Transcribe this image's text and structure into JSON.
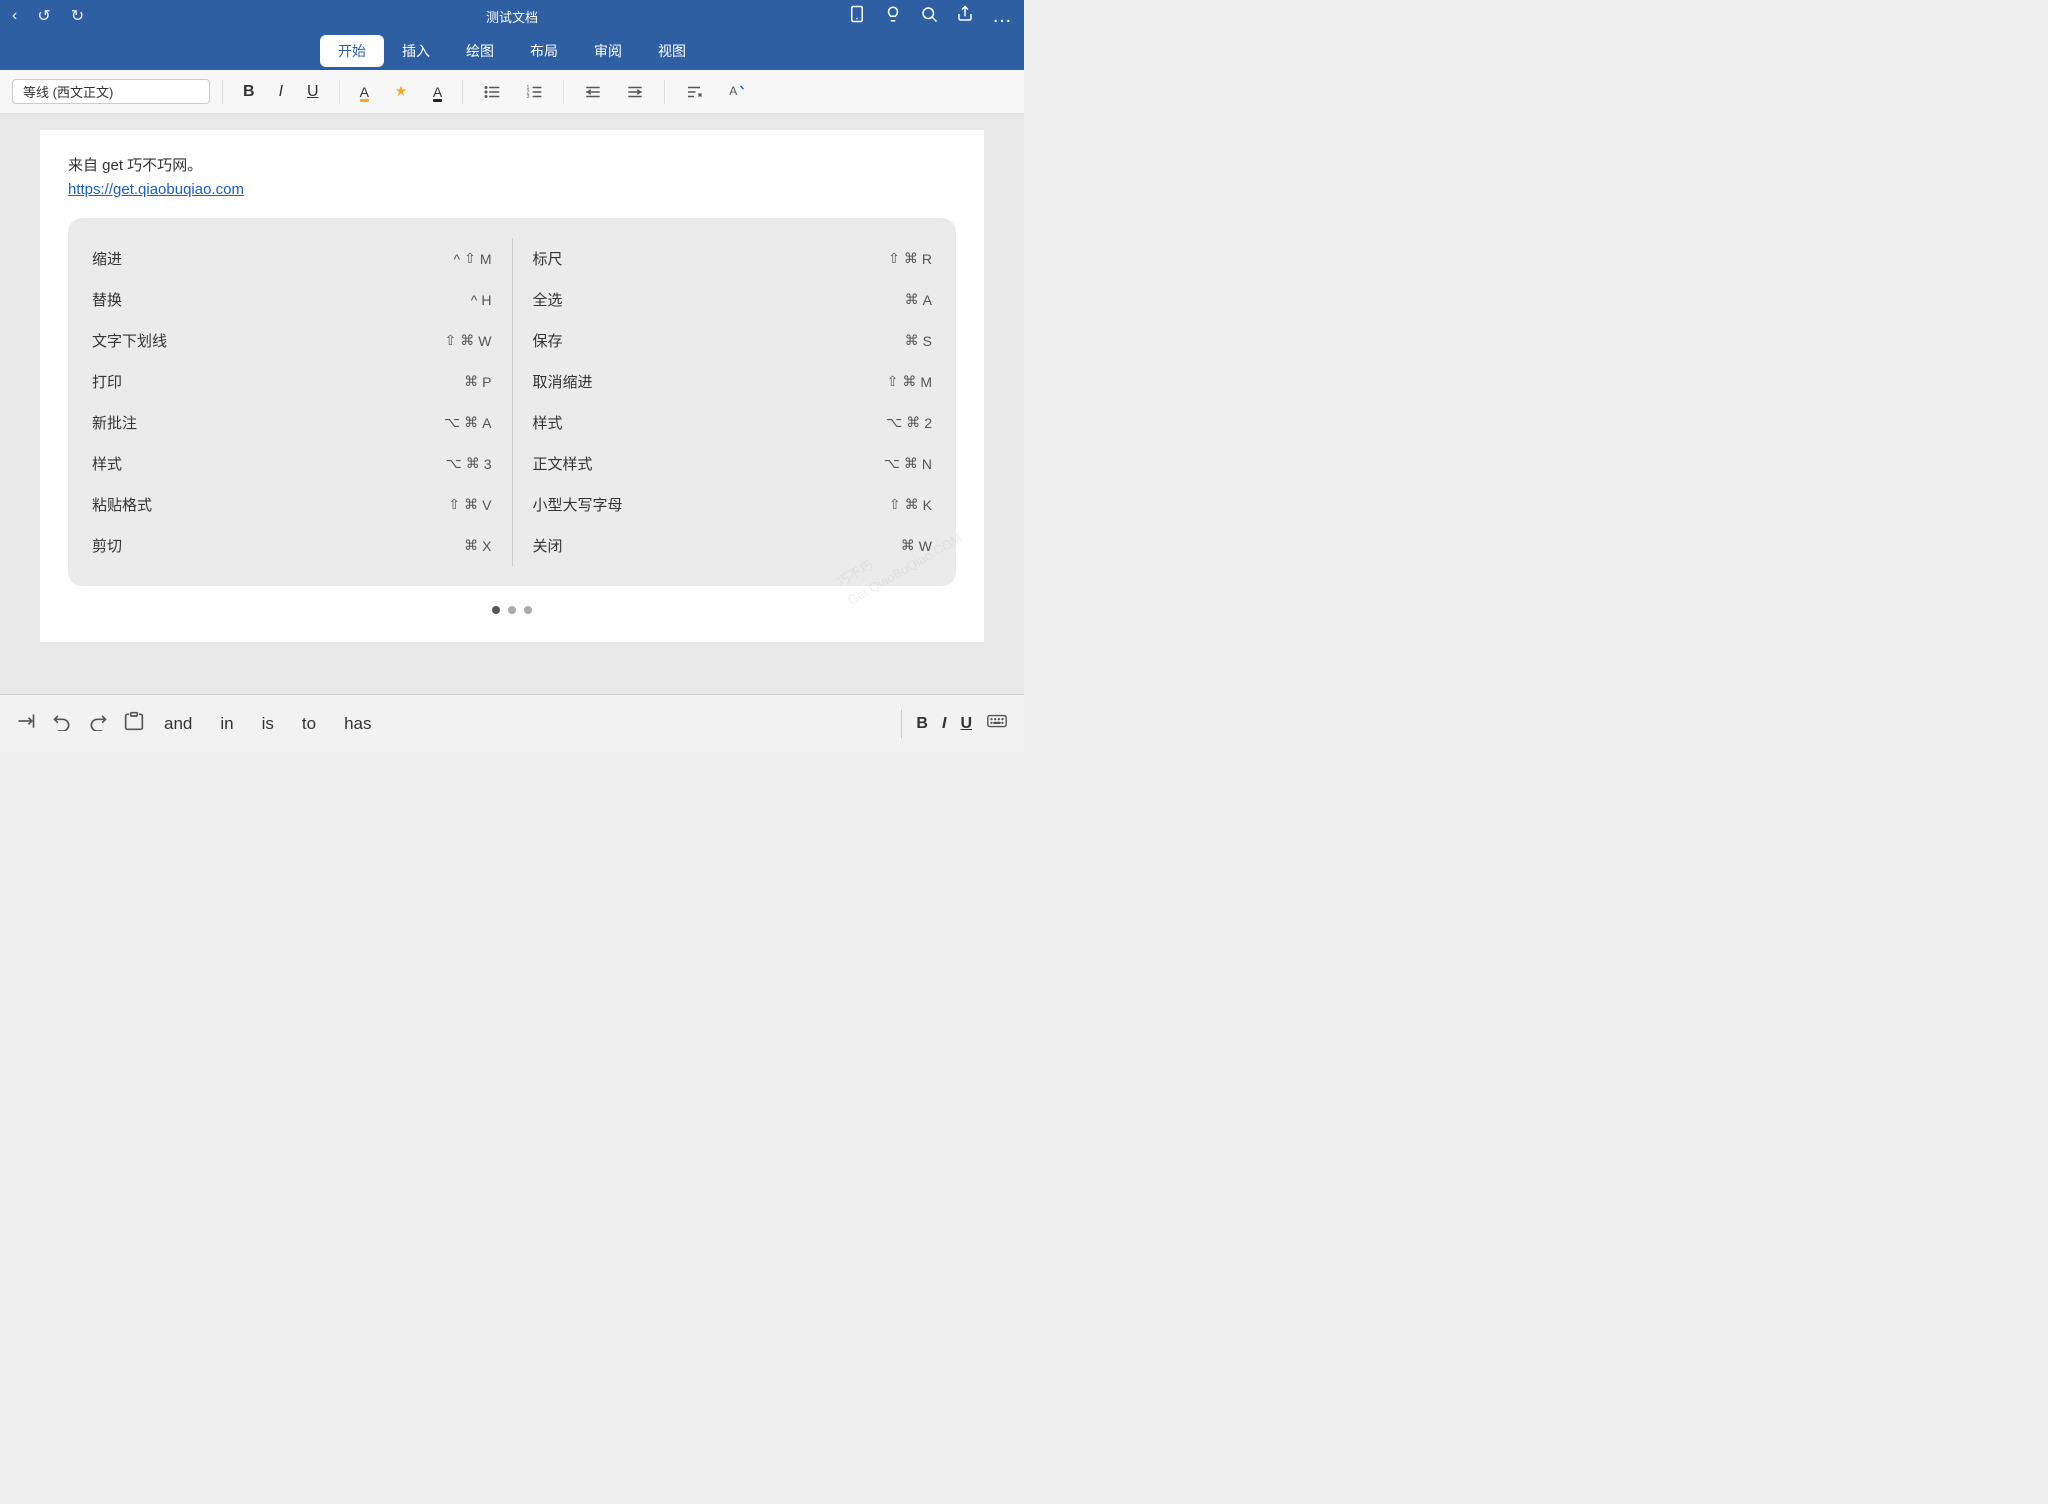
{
  "titleBar": {
    "title": "测试文档",
    "back": "‹",
    "undo": "↩",
    "redo": "↪",
    "icons": [
      "📱",
      "💡",
      "🔍",
      "⬆",
      "…"
    ]
  },
  "menuBar": {
    "items": [
      "开始",
      "插入",
      "绘图",
      "布局",
      "审阅",
      "视图"
    ],
    "active": 0
  },
  "toolbar": {
    "font": "等线 (西文正文)",
    "bold": "B",
    "italic": "I",
    "underline": "U"
  },
  "document": {
    "text": "来自 get 巧不巧网。",
    "link": "https://get.qiaobuqiao.com"
  },
  "shortcuts": {
    "left": [
      {
        "label": "缩进",
        "keys": "^ ⇧ M"
      },
      {
        "label": "替换",
        "keys": "^ H"
      },
      {
        "label": "文字下划线",
        "keys": "⇧ ⌘ W"
      },
      {
        "label": "打印",
        "keys": "⌘ P"
      },
      {
        "label": "新批注",
        "keys": "⌥ ⌘ A"
      },
      {
        "label": "样式",
        "keys": "⌥ ⌘ 3"
      },
      {
        "label": "粘贴格式",
        "keys": "⇧ ⌘ V"
      },
      {
        "label": "剪切",
        "keys": "⌘ X"
      }
    ],
    "right": [
      {
        "label": "标尺",
        "keys": "⇧ ⌘ R"
      },
      {
        "label": "全选",
        "keys": "⌘ A"
      },
      {
        "label": "保存",
        "keys": "⌘ S"
      },
      {
        "label": "取消缩进",
        "keys": "⇧ ⌘ M"
      },
      {
        "label": "样式",
        "keys": "⌥ ⌘ 2"
      },
      {
        "label": "正文样式",
        "keys": "⌥ ⌘ N"
      },
      {
        "label": "小型大写字母",
        "keys": "⇧ ⌘ K"
      },
      {
        "label": "关闭",
        "keys": "⌘ W"
      }
    ]
  },
  "pagination": {
    "dots": 3,
    "active": 0
  },
  "bottomBar": {
    "suggestions": [
      "and",
      "in",
      "is",
      "to",
      "has"
    ],
    "formatButtons": [
      "B",
      "I",
      "U"
    ]
  }
}
